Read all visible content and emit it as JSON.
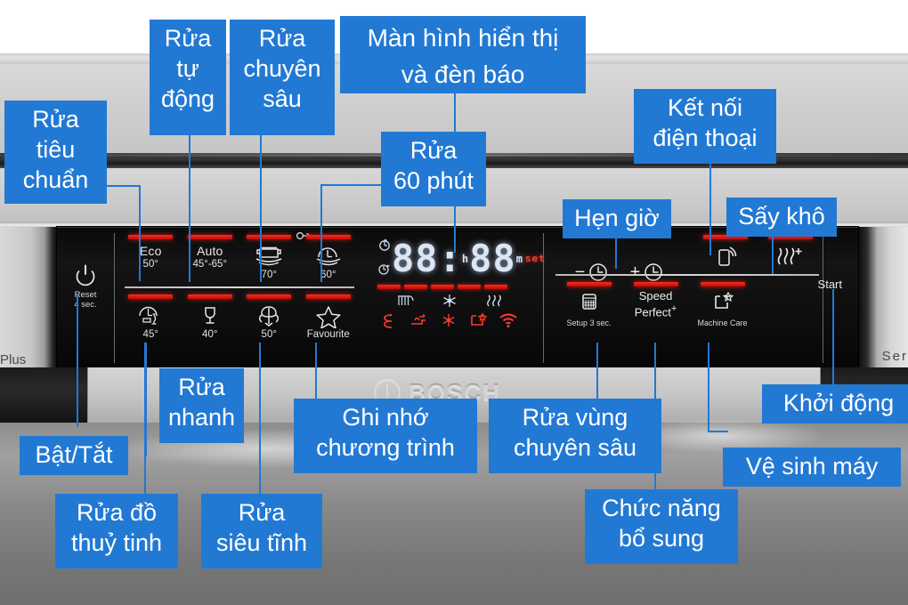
{
  "product": {
    "brand": "BOSCH",
    "left_edge_text": "Plus",
    "right_edge_text": "Ser"
  },
  "panel": {
    "power": {
      "reset_line1": "Reset",
      "reset_line2": "4 sec."
    },
    "programs_row1": [
      {
        "name": "Eco",
        "temp": "50°",
        "icon": "leaf-eco-icon"
      },
      {
        "name": "Auto",
        "temp": "45°-65°",
        "icon": "auto-icon"
      },
      {
        "name": "",
        "temp": "70°",
        "icon": "intensive-pot-icon"
      },
      {
        "name": "",
        "temp": "60°",
        "icon": "timer-plate-icon"
      }
    ],
    "programs_row2": [
      {
        "name": "",
        "temp": "45°",
        "icon": "quick-glass-icon"
      },
      {
        "name": "",
        "temp": "40°",
        "icon": "glass-icon"
      },
      {
        "name": "",
        "temp": "50°",
        "icon": "silence-fan-icon"
      },
      {
        "name": "Favourite",
        "temp": "",
        "icon": "star-icon"
      }
    ],
    "lock_icon": "child-lock-icon",
    "display": {
      "time_hours": "88",
      "time_minutes": "88",
      "separator": ":",
      "unit_h": "h",
      "unit_m": "m",
      "set_label": "set",
      "left_icons": [
        "timer-delay-icon",
        "duration-icon"
      ],
      "progress_segments": 5,
      "status_icons_white": [
        "prewash-icon",
        "snowflake-dry-icon",
        "drying-heat-icon"
      ],
      "status_icons_red": [
        "salt-refill-icon",
        "rinse-aid-icon",
        "clean-sparkle-icon",
        "machine-care-icon",
        "wifi-icon"
      ]
    },
    "timer": {
      "minus": "−",
      "plus": "+",
      "icon": "clock-icon"
    },
    "options": [
      {
        "label": "",
        "sub": "",
        "icon": "phone-connect-icon"
      },
      {
        "label": "",
        "sub": "",
        "icon": "extra-dry-icon"
      },
      {
        "label": "",
        "sub": "Setup 3 sec.",
        "icon": "setup-grid-icon"
      },
      {
        "label": "Speed",
        "label2": "Perfect",
        "sup": "+",
        "sub": "",
        "icon": "speed-perfect-text"
      },
      {
        "label": "",
        "sub": "Machine Care",
        "icon": "machine-care-icon"
      }
    ],
    "start_label": "Start"
  },
  "annotations": [
    {
      "id": "rua-tieu-chuan",
      "text": "Rửa\ntiêu\nchuẩn"
    },
    {
      "id": "rua-tu-dong",
      "text": "Rửa\ntự\nđộng"
    },
    {
      "id": "rua-chuyen-sau",
      "text": "Rửa\nchuyên\nsâu"
    },
    {
      "id": "man-hinh-den-bao",
      "text": "Màn hình hiển thị\nvà đèn báo"
    },
    {
      "id": "rua-60-phut",
      "text": "Rửa\n60 phút"
    },
    {
      "id": "ket-noi-dien-thoai",
      "text": "Kết nối\nđiện thoại"
    },
    {
      "id": "hen-gio",
      "text": "Hẹn giờ"
    },
    {
      "id": "say-kho",
      "text": "Sấy khô"
    },
    {
      "id": "bat-tat",
      "text": "Bật/Tắt"
    },
    {
      "id": "rua-nhanh",
      "text": "Rửa\nnhanh"
    },
    {
      "id": "rua-do-thuy-tinh",
      "text": "Rửa đồ\nthuỷ tinh"
    },
    {
      "id": "rua-sieu-tinh",
      "text": "Rửa\nsiêu tĩnh"
    },
    {
      "id": "ghi-nho-chuong-trinh",
      "text": "Ghi nhớ\nchương trình"
    },
    {
      "id": "rua-vung-chuyen-sau",
      "text": "Rửa vùng\nchuyên sâu"
    },
    {
      "id": "chuc-nang-bo-sung",
      "text": "Chức năng\nbổ sung"
    },
    {
      "id": "ve-sinh-may",
      "text": "Vệ sinh máy"
    },
    {
      "id": "khoi-dong",
      "text": "Khởi động"
    }
  ],
  "colors": {
    "tag_blue": "#2279d4",
    "indicator_red": "#ff2a1e",
    "panel_black": "#0d0d0d",
    "lcd_white": "#dbe6f2"
  }
}
